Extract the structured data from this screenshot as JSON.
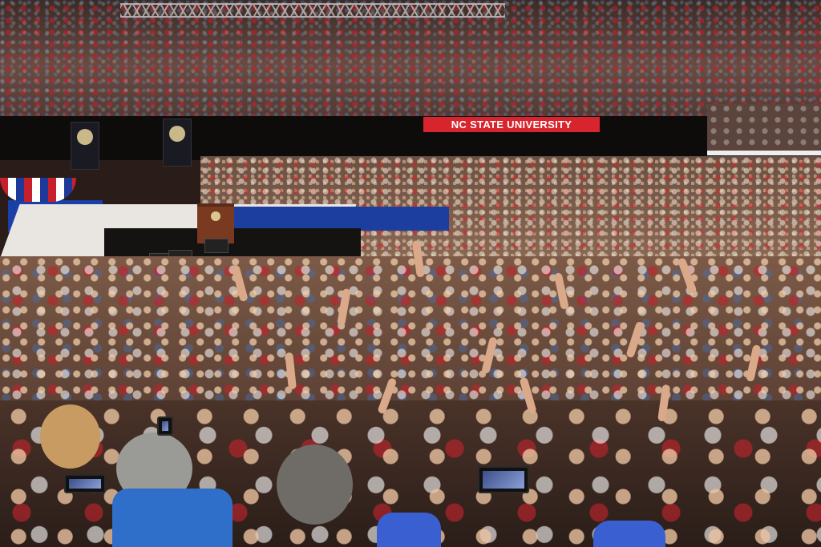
{
  "scene": {
    "type": "photograph",
    "banner_text": "NC STATE UNIVERSITY",
    "colors": {
      "banner_red": "#d8242d",
      "stage_blue": "#1c3e9e",
      "podium": "#7a3a22"
    }
  }
}
